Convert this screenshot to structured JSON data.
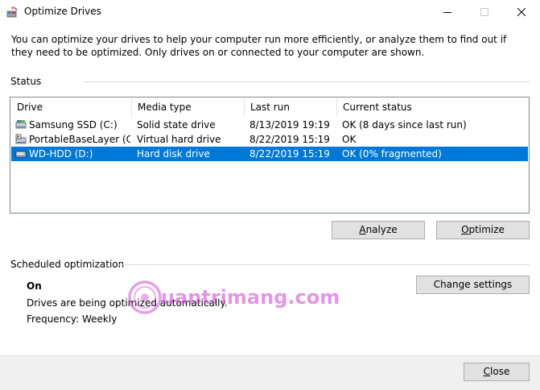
{
  "window": {
    "title": "Optimize Drives",
    "icon": "defrag-app-icon"
  },
  "description": "You can optimize your drives to help your computer run more efficiently, or analyze them to find out if they need to be optimized. Only drives on or connected to your computer are shown.",
  "status": {
    "label": "Status",
    "columns": [
      "Drive",
      "Media type",
      "Last run",
      "Current status"
    ],
    "rows": [
      {
        "drive": "Samsung SSD (C:)",
        "media": "Solid state drive",
        "last_run": "8/13/2019 19:19",
        "status": "OK (8 days since last run)",
        "icon": "ssd-drive-icon",
        "selected": false
      },
      {
        "drive": "PortableBaseLayer (C:\\...",
        "media": "Virtual hard drive",
        "last_run": "8/22/2019 15:19",
        "status": "OK",
        "icon": "virtual-drive-icon",
        "selected": false
      },
      {
        "drive": "WD-HDD (D:)",
        "media": "Hard disk drive",
        "last_run": "8/22/2019 15:19",
        "status": "OK (0% fragmented)",
        "icon": "hdd-drive-icon",
        "selected": true
      }
    ]
  },
  "buttons": {
    "analyze_prefix": "",
    "analyze_accel": "A",
    "analyze_rest": "nalyze",
    "optimize_prefix": "",
    "optimize_accel": "O",
    "optimize_rest": "ptimize",
    "change_settings": "Change settings",
    "close_prefix": "",
    "close_accel": "C",
    "close_rest": "lose"
  },
  "scheduled": {
    "label": "Scheduled optimization",
    "state": "On",
    "detail": "Drives are being optimized automatically.",
    "frequency": "Frequency: Weekly"
  },
  "watermark": {
    "text": "uantrimang.com",
    "color": "#d14fd6"
  },
  "colors": {
    "selection": "#0078d7",
    "button_face": "#e1e1e1",
    "footer": "#f0f0f0"
  }
}
